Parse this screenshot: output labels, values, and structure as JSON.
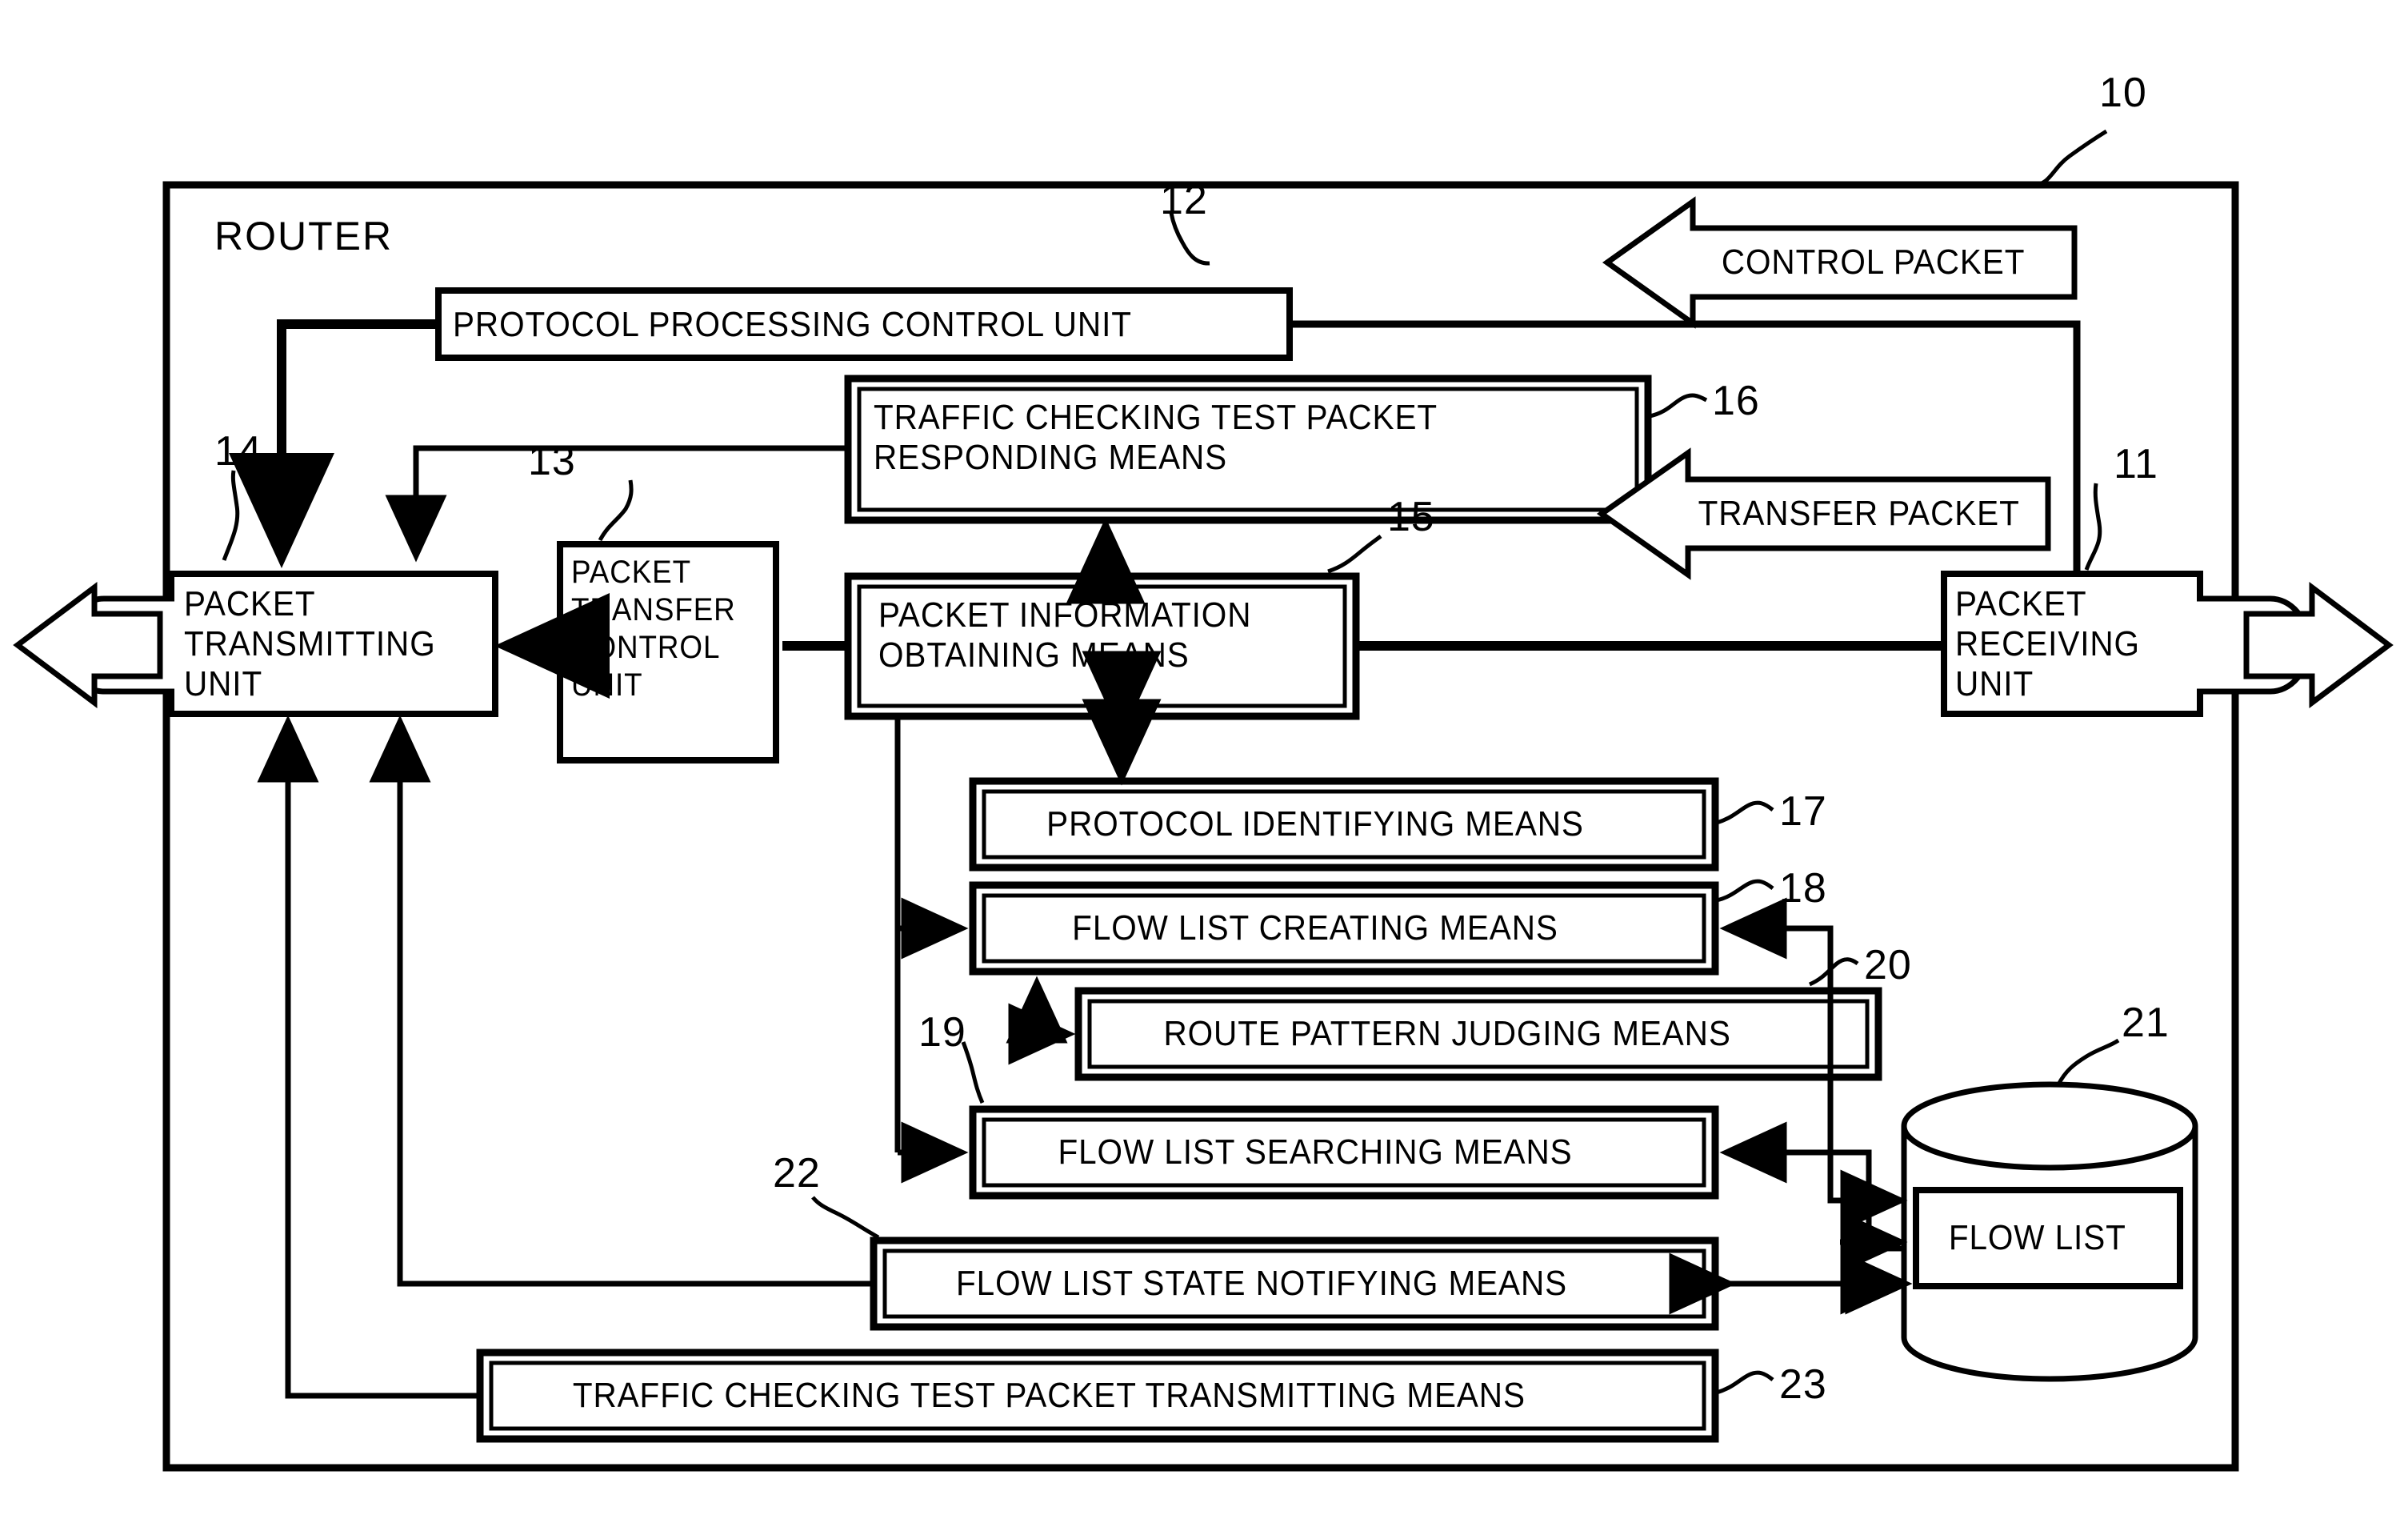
{
  "figure": {
    "type": "patent-block-diagram",
    "outer_label": "10",
    "router_title": "ROUTER"
  },
  "blocks": [
    {
      "id": "protocol_processing_control_unit",
      "label": "PROTOCOL PROCESSING CONTROL UNIT",
      "ref": "12",
      "double_border": false
    },
    {
      "id": "traffic_checking_test_packet_responding_means",
      "label": "TRAFFIC CHECKING TEST PACKET\nRESPONDING MEANS",
      "ref": "16",
      "double_border": true
    },
    {
      "id": "packet_transmitting_unit",
      "label": "PACKET\nTRANSMITTING\nUNIT",
      "ref": "14",
      "double_border": false
    },
    {
      "id": "packet_transfer_control_unit",
      "label": "PACKET\nTRANSFER\nCONTROL\nUNIT",
      "ref": "13",
      "double_border": false
    },
    {
      "id": "packet_information_obtaining_means",
      "label": "PACKET INFORMATION\nOBTAINING MEANS",
      "ref": "15",
      "double_border": true
    },
    {
      "id": "packet_receiving_unit",
      "label": "PACKET\nRECEIVING\nUNIT",
      "ref": "11",
      "double_border": false
    },
    {
      "id": "protocol_identifying_means",
      "label": "PROTOCOL IDENTIFYING MEANS",
      "ref": "17",
      "double_border": true
    },
    {
      "id": "flow_list_creating_means",
      "label": "FLOW LIST CREATING MEANS",
      "ref": "18",
      "double_border": true
    },
    {
      "id": "route_pattern_judging_means",
      "label": "ROUTE PATTERN JUDGING MEANS",
      "ref": "20",
      "double_border": true
    },
    {
      "id": "flow_list_searching_means",
      "label": "FLOW LIST SEARCHING MEANS",
      "ref": "19",
      "double_border": true
    },
    {
      "id": "flow_list_state_notifying_means",
      "label": "FLOW LIST STATE NOTIFYING MEANS",
      "ref": "22",
      "double_border": true
    },
    {
      "id": "traffic_checking_test_packet_transmitting_means",
      "label": "TRAFFIC CHECKING TEST PACKET TRANSMITTING MEANS",
      "ref": "23",
      "double_border": true
    },
    {
      "id": "flow_list_store",
      "label": "FLOW LIST",
      "ref": "21",
      "double_border": false
    }
  ],
  "arrow_labels": [
    {
      "id": "control_packet",
      "label": "CONTROL PACKET"
    },
    {
      "id": "transfer_packet",
      "label": "TRANSFER PACKET"
    }
  ],
  "reference_numerals": [
    "10",
    "11",
    "12",
    "13",
    "14",
    "15",
    "16",
    "17",
    "18",
    "19",
    "20",
    "21",
    "22",
    "23"
  ],
  "colors": {
    "line": "#000000",
    "background": "#ffffff"
  }
}
